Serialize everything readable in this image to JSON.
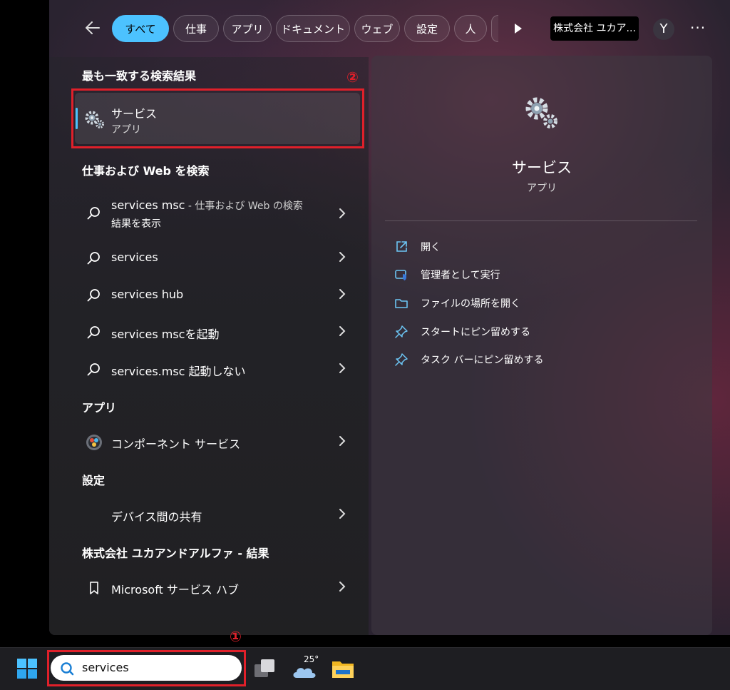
{
  "filters": {
    "tabs": [
      {
        "label": "すべて"
      },
      {
        "label": "仕事"
      },
      {
        "label": "アプリ"
      },
      {
        "label": "ドキュメント"
      },
      {
        "label": "ウェブ"
      },
      {
        "label": "設定"
      },
      {
        "label": "人"
      }
    ],
    "org_label": "株式会社 ユカア...",
    "avatar_initial": "Y",
    "more_label": "···"
  },
  "best_match": {
    "heading": "最も一致する検索結果",
    "title": "サービス",
    "subtitle": "アプリ",
    "annotation": "②"
  },
  "web": {
    "heading": "仕事および Web を検索",
    "items": [
      {
        "bold": "services msc",
        "rest": " - 仕事および Web の検索",
        "sub": "結果を表示"
      },
      {
        "label": "services"
      },
      {
        "label": "services hub"
      },
      {
        "label": "services mscを起動"
      },
      {
        "label": "services.msc 起動しない"
      }
    ]
  },
  "apps": {
    "heading": "アプリ",
    "items": [
      {
        "label": "コンポーネント サービス"
      }
    ]
  },
  "settings": {
    "heading": "設定",
    "items": [
      {
        "label": "デバイス間の共有"
      }
    ]
  },
  "org_results": {
    "heading": "株式会社 ユカアンドアルファ - 結果",
    "items": [
      {
        "label": "Microsoft サービス ハブ"
      }
    ]
  },
  "details": {
    "title": "サービス",
    "subtitle": "アプリ",
    "actions": [
      {
        "label": "開く",
        "icon": "open-external-icon"
      },
      {
        "label": "管理者として実行",
        "icon": "shield-admin-icon"
      },
      {
        "label": "ファイルの場所を開く",
        "icon": "folder-icon"
      },
      {
        "label": "スタートにピン留めする",
        "icon": "pin-icon"
      },
      {
        "label": "タスク バーにピン留めする",
        "icon": "pin-icon"
      }
    ]
  },
  "taskbar": {
    "search_value": "services",
    "annotation": "①",
    "weather_temp": "25°"
  },
  "colors": {
    "accent": "#4cc2ff",
    "annotation_red": "#e0202a"
  }
}
